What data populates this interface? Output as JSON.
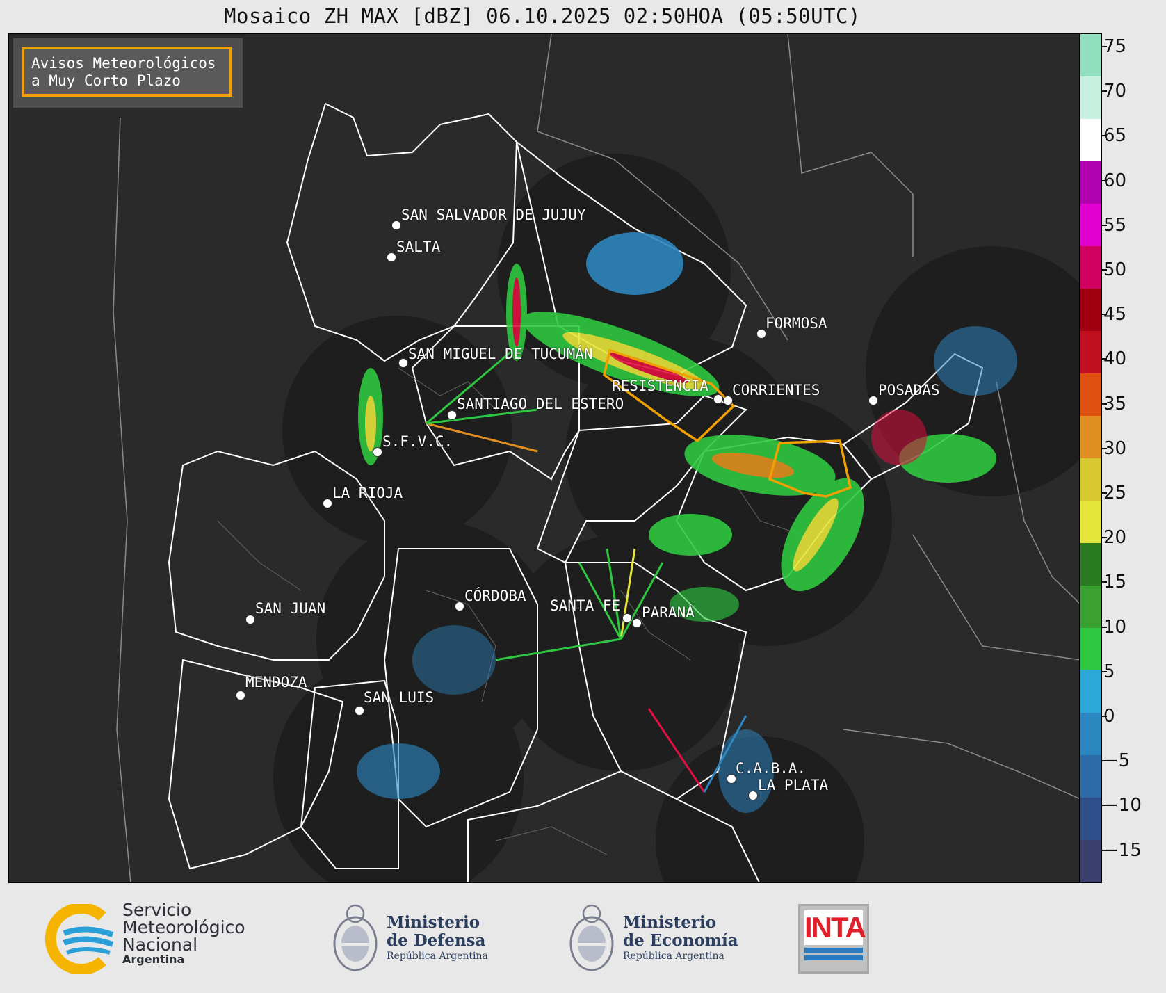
{
  "title": "Mosaico ZH MAX [dBZ] 06.10.2025 02:50HOA (05:50UTC)",
  "avisos": {
    "line1": "Avisos Meteorológicos",
    "line2": "a Muy Corto Plazo"
  },
  "cities": [
    {
      "name": "SAN SALVADOR DE JUJUY"
    },
    {
      "name": "SALTA"
    },
    {
      "name": "FORMOSA"
    },
    {
      "name": "SAN MIGUEL DE TUCUMÁN"
    },
    {
      "name": "RESISTENCIA"
    },
    {
      "name": "CORRIENTES"
    },
    {
      "name": "POSADAS"
    },
    {
      "name": "SANTIAGO DEL ESTERO"
    },
    {
      "name": "S.F.V.C."
    },
    {
      "name": "LA RIOJA"
    },
    {
      "name": "CÓRDOBA"
    },
    {
      "name": "SANTA FE"
    },
    {
      "name": "PARANÁ"
    },
    {
      "name": "SAN JUAN"
    },
    {
      "name": "MENDOZA"
    },
    {
      "name": "SAN LUIS"
    },
    {
      "name": "C.A.B.A."
    },
    {
      "name": "LA PLATA"
    }
  ],
  "colorbar": {
    "ticks": [
      "75",
      "70",
      "65",
      "60",
      "55",
      "50",
      "45",
      "40",
      "35",
      "30",
      "25",
      "20",
      "15",
      "10",
      "5",
      "0",
      "−5",
      "−10",
      "−15"
    ],
    "colors": [
      "#3a3f6e",
      "#2f4f8a",
      "#2d6aa8",
      "#2c86c0",
      "#2ba8d8",
      "#2ec840",
      "#3aa030",
      "#2a7a22",
      "#e6e63a",
      "#d8c830",
      "#e09020",
      "#e05010",
      "#c01020",
      "#a00010",
      "#d00060",
      "#e000d0",
      "#b000b0",
      "#ffffff",
      "#c8f0e0",
      "#90e0c0"
    ]
  },
  "footer": {
    "smn_line1": "Servicio",
    "smn_line2": "Meteorológico",
    "smn_line3": "Nacional",
    "smn_line4": "Argentina",
    "def_line1": "Ministerio",
    "def_line2": "de Defensa",
    "def_line3": "República Argentina",
    "eco_line1": "Ministerio",
    "eco_line2": "de Economía",
    "eco_line3": "República Argentina",
    "inta": "INTA"
  }
}
